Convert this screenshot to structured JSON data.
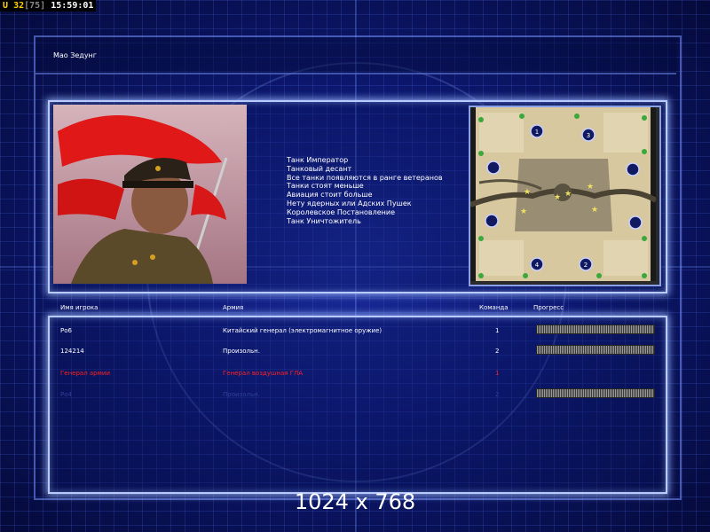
{
  "hud": {
    "u_label": "U",
    "unit_count": "32",
    "unit_cap": "[75]",
    "time": "15:59:01"
  },
  "player": {
    "name": "Мао Зедунг"
  },
  "bonuses": [
    "Танк Император",
    "Танковый десант",
    "Все танки появляются в ранге ветеранов",
    "Танки стоят меньше",
    "Авиация стоит больше",
    "Нету ядерных или Адских Пушек",
    "Королевское Постановление",
    "Танк Уничтожитель"
  ],
  "minimap": {
    "start_labels": [
      "1",
      "2",
      "3",
      "4"
    ]
  },
  "table": {
    "headers": {
      "name": "Имя игрока",
      "army": "Армия",
      "team": "Команда",
      "progress": "Прогресс"
    },
    "rows": [
      {
        "name": "Ро6",
        "army": "Китайский генерал (электромагнитное оружие)",
        "team": "1",
        "style": "normal",
        "progress": 1.0
      },
      {
        "name": "124214",
        "army": "Произольн.",
        "team": "2",
        "style": "normal",
        "progress": 1.0
      },
      {
        "name": "Генерал армии",
        "army": "Генерал воздушная ГЛА",
        "team": "1",
        "style": "red",
        "progress": null
      },
      {
        "name": "Ро4",
        "army": "Произольн.",
        "team": "2",
        "style": "dim",
        "progress": 1.0
      }
    ]
  },
  "resolution_label": "1024 x 768",
  "colors": {
    "background": "#0c1870",
    "panel_border": "#b8caff",
    "hud_accent": "#ffd200",
    "error_red": "#ff2020"
  }
}
